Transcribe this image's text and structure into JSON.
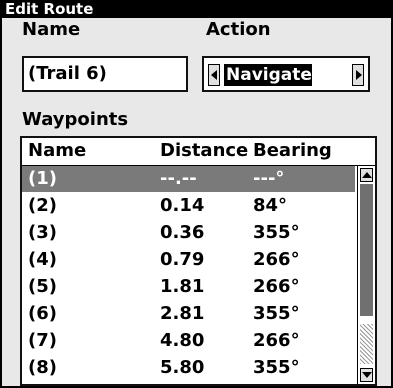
{
  "title": "Edit Route",
  "name_label": "Name",
  "action_label": "Action",
  "route_name": "(Trail 6)",
  "action": {
    "value": "Navigate",
    "prev_icon": "left-arrow-icon",
    "next_icon": "right-arrow-icon"
  },
  "waypoints_label": "Waypoints",
  "table": {
    "columns": [
      "Name",
      "Distance",
      "Bearing"
    ],
    "rows": [
      {
        "name": "(1)",
        "distance": "--.--",
        "bearing": "---°",
        "selected": true
      },
      {
        "name": "(2)",
        "distance": "0.14",
        "bearing": "84°"
      },
      {
        "name": "(3)",
        "distance": "0.36",
        "bearing": "355°"
      },
      {
        "name": "(4)",
        "distance": "0.79",
        "bearing": "266°"
      },
      {
        "name": "(5)",
        "distance": "1.81",
        "bearing": "266°"
      },
      {
        "name": "(6)",
        "distance": "2.81",
        "bearing": "355°"
      },
      {
        "name": "(7)",
        "distance": "4.80",
        "bearing": "266°"
      },
      {
        "name": "(8)",
        "distance": "5.80",
        "bearing": "355°"
      }
    ]
  },
  "scroll": {
    "up_icon": "scroll-up-arrow-icon",
    "down_icon": "scroll-down-arrow-icon"
  },
  "colors": {
    "selection": "#7a7a7a",
    "panel": "#e8e8e8",
    "highlight": "#000000"
  }
}
